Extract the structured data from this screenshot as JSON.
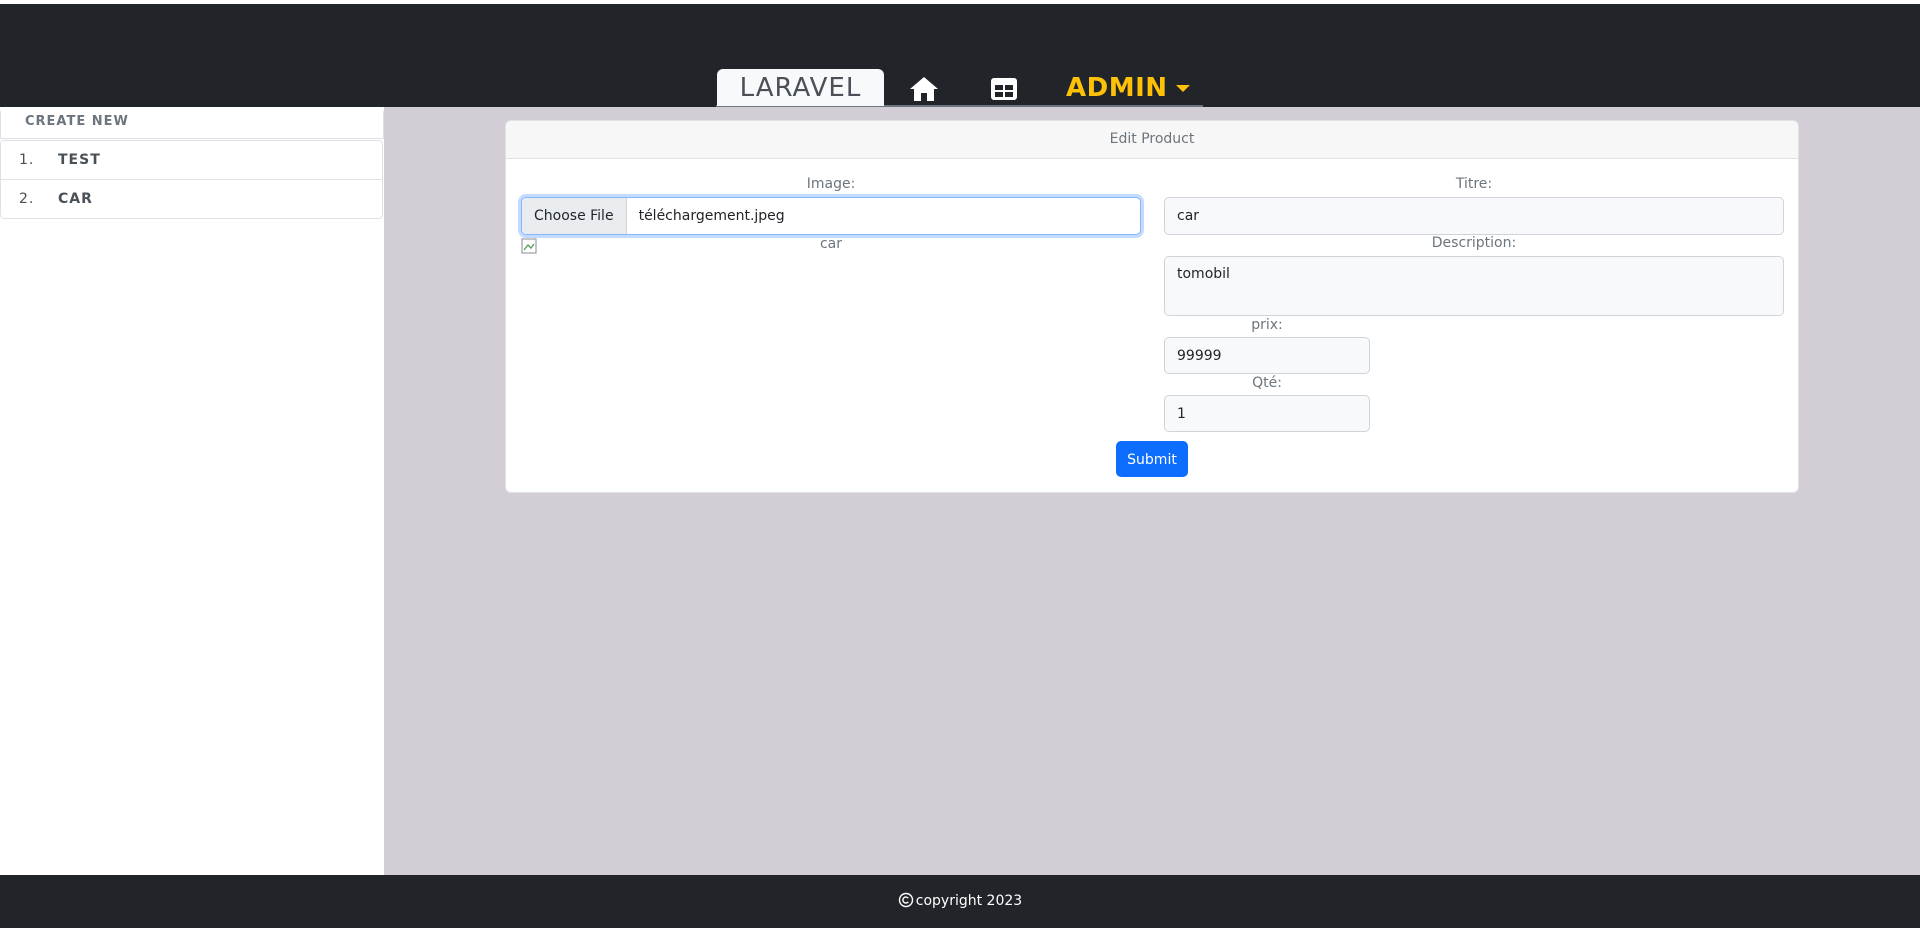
{
  "navbar": {
    "brand": "LARAVEL",
    "home_icon": "home-icon",
    "table_icon": "table-icon",
    "admin_label": "ADMIN",
    "brand_bg": "#f8f9fa",
    "accent": "#ffc107"
  },
  "sidebar": {
    "create_new": "CREATE NEW",
    "items": [
      {
        "num": "1.",
        "label": "TEST"
      },
      {
        "num": "2.",
        "label": "CAR"
      }
    ]
  },
  "form": {
    "header": "Edit Product",
    "image_label": "Image:",
    "file_button": "Choose File",
    "file_name": "téléchargement.jpeg",
    "image_alt": "car",
    "titre_label": "Titre:",
    "titre_value": "car",
    "description_label": "Description:",
    "description_value": "tomobil",
    "prix_label": "prix:",
    "prix_value": "99999",
    "qte_label": "Qté:",
    "qte_value": "1",
    "submit_label": "Submit",
    "submit_color": "#0d6efd"
  },
  "footer": {
    "copyright": "copyright 2023"
  }
}
